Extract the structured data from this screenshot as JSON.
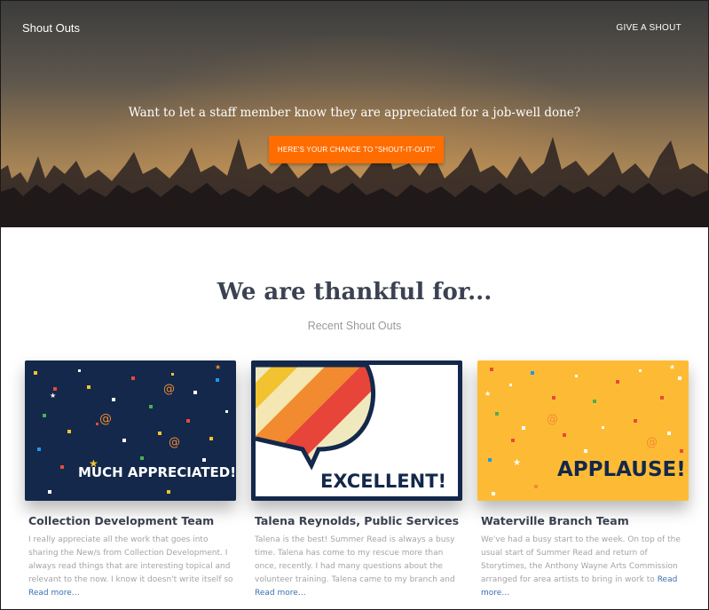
{
  "header": {
    "brand": "Shout Outs",
    "nav_give": "GIVE A SHOUT"
  },
  "hero": {
    "question": "Want to let a staff member know they are appreciated for a job-well done?",
    "cta_label": "HERE'S YOUR CHANCE TO \"SHOUT-IT-OUT!\""
  },
  "section": {
    "title": "We are thankful for...",
    "subtitle": "Recent Shout Outs"
  },
  "colors": {
    "cta": "#ff6d00",
    "navy": "#13284a",
    "yellow": "#fdbb35",
    "title": "#3b4252",
    "link": "#3a6fb0"
  },
  "cards": [
    {
      "image_text": "MUCH APPRECIATED!",
      "title": "Collection Development Team",
      "text": "I really appreciate all the work that goes into sharing the New/s from Collection Development. I always read things that are interesting topical and relevant to the now. I know it doesn't write itself so",
      "read_more": "Read more…"
    },
    {
      "image_text": "EXCELLENT!",
      "title": "Talena Reynolds, Public Services",
      "text": "Talena is the best! Summer Read is always a busy time. Talena has come to my rescue more than once, recently. I had many questions about the volunteer training. Talena came to my branch and",
      "read_more": "Read more…"
    },
    {
      "image_text": "APPLAUSE!",
      "title": "Waterville Branch Team",
      "text": "We've had a busy start to the week. On top of the usual start of Summer Read and return of Storytimes, the Anthony Wayne Arts Commission arranged for area artists to bring in work to",
      "read_more": "Read more…"
    }
  ]
}
